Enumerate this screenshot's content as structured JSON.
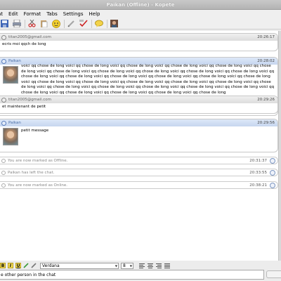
{
  "window": {
    "title": "Paikan (Offline) - Kopete"
  },
  "menu": {
    "items": [
      "at",
      "Edit",
      "Format",
      "Tabs",
      "Settings",
      "Help"
    ]
  },
  "toolbar": {
    "icons": [
      "save-icon",
      "print-icon",
      "cut-icon",
      "paste-icon",
      "smiley-icon",
      "pencil-icon",
      "spellcheck-icon",
      "speech-bubble-icon",
      "contact-photo-icon"
    ]
  },
  "messages": [
    {
      "kind": "out",
      "sender": "titan2005@gmail.com",
      "time": "20:26:17",
      "text": "ecris moi qqch de long"
    },
    {
      "kind": "in",
      "sender": "Paikan",
      "time": "20:28:02",
      "text": "voici qq chose de long voici qq chose de long voici qq chose de long voici qq chose de long voici qq chose de long voici qq chose de long voici qq chose de long voici qq chose de long voici qq chose de long voici qq chose de long voici qq chose de long voici qq chose de long voici qq chose de long voici qq chose de long voici qq chose de long voici qq chose de long voici qq chose de long voici qq chose de long voici qq chose de long voici qq chose de long voici qq chose de long voici qq chose de long voici qq chose de long voici qq chose de long voici qq chose de long voici qq chose de long voici qq chose de long voici qq chose de long voici qq chose de long voici qq chose de long voici qq chose de long voici qq chose de long voici qq chose de long"
    },
    {
      "kind": "out",
      "sender": "titan2005@gmail.com",
      "time": "20:29:26",
      "text": "et maintenant de petit"
    },
    {
      "kind": "in",
      "sender": "Paikan",
      "time": "20:29:56",
      "text": "petit message"
    }
  ],
  "statuses": [
    {
      "text": "You are now marked as Offline.",
      "time": "20:31:37"
    },
    {
      "text": "Paikan has left the chat.",
      "time": "20:33:55"
    },
    {
      "text": "You are now marked as Online.",
      "time": "20:38:21"
    }
  ],
  "format": {
    "font": "Verdana",
    "size": "8"
  },
  "input": {
    "text": "e other person in the chat"
  }
}
